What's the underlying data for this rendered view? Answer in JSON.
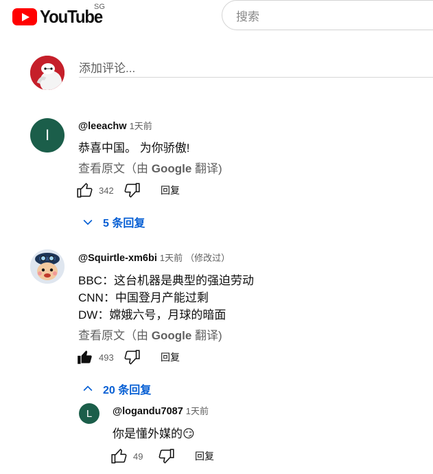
{
  "header": {
    "logo_text": "YouTube",
    "region": "SG",
    "search_placeholder": "搜索"
  },
  "composer": {
    "placeholder": "添加评论..."
  },
  "comments": [
    {
      "handle": "@leeachw",
      "time": "1天前",
      "avatar_letter": "I",
      "avatar_color": "#1b5e4a",
      "lines": [
        "恭喜中国。 为你骄傲!"
      ],
      "translate_prefix": "查看原文（由 ",
      "translate_brand": "Google",
      "translate_suffix": " 翻译)",
      "likes": "342",
      "reply_label": "回复",
      "replies_toggle": "5 条回复"
    },
    {
      "handle": "@Squirtle-xm6bi",
      "time": "1天前",
      "edited": "（修改过）",
      "lines": [
        "BBC：这台机器是典型的强迫劳动",
        "CNN：中国登月产能过剩",
        "DW：嫦娥六号，月球的暗面"
      ],
      "translate_prefix": "查看原文（由 ",
      "translate_brand": "Google",
      "translate_suffix": " 翻译)",
      "likes": "493",
      "reply_label": "回复",
      "replies_toggle": "20 条回复"
    },
    {
      "handle": "@logandu7087",
      "time": "1天前",
      "avatar_letter": "L",
      "avatar_color": "#1b5e4a",
      "lines": [
        "你是懂外媒的"
      ],
      "emoji": "😏",
      "likes": "49",
      "reply_label": "回复"
    }
  ]
}
